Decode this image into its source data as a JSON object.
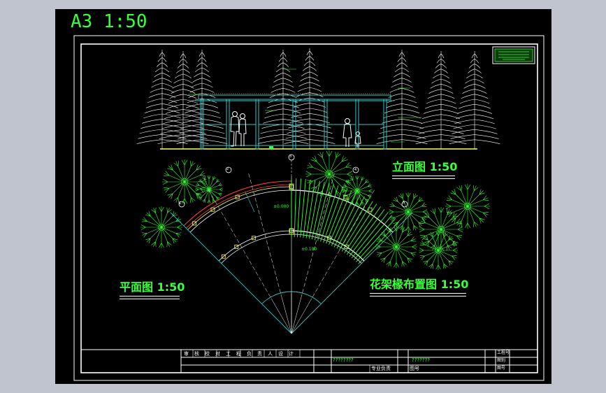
{
  "sheet": {
    "title": "A3 1:50",
    "background": "#000000",
    "accent": "#39ff39"
  },
  "views": {
    "elevation_label": "立面图 1:50",
    "plan_label": "平面图 1:50",
    "rafter_label": "花架椽布置图 1:50"
  },
  "annotations": {
    "axis_1": "1",
    "axis_2": "2",
    "axis_3": "3",
    "axis_4": "4",
    "axis_5": "5",
    "level_1": "±0.000",
    "level_2": "±0.100"
  },
  "title_block": {
    "project_name": "????????",
    "drawing_name": "???????",
    "header_cells": [
      "审",
      "核",
      "校",
      "对",
      "工",
      "程",
      "负",
      "责",
      "人",
      "设",
      "计"
    ],
    "left_bottom": "专业负责",
    "sheet_label": "图号",
    "right_rows": [
      "工程号",
      "图别",
      "图号"
    ]
  }
}
